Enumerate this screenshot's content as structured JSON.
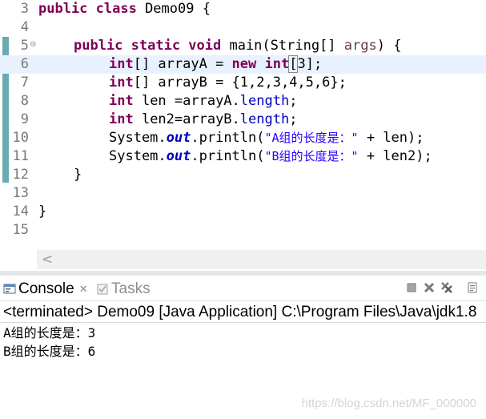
{
  "editor": {
    "line_numbers": [
      "3",
      "4",
      "5",
      "6",
      "7",
      "8",
      "9",
      "10",
      "11",
      "12",
      "13",
      "14",
      "15"
    ],
    "class_decl": {
      "kw": "public class",
      "rest": " Demo09 {"
    },
    "main_decl": {
      "kw": "public static void",
      "rest": " main(String[] ",
      "param": "args",
      "tail": ") {"
    },
    "line6": {
      "kw1": "int",
      "a": "[] arrayA = ",
      "kw2": "new",
      "sp": " ",
      "kw3": "int",
      "br": "[",
      "b": "3];"
    },
    "line7": {
      "kw": "int",
      "rest": "[] arrayB = {1,2,3,4,5,6};"
    },
    "line8": {
      "kw": "int",
      "rest": " len =arrayA.",
      "field": "length",
      "end": ";"
    },
    "line9": {
      "kw": "int",
      "rest": " len2=arrayB.",
      "field": "length",
      "end": ";"
    },
    "line10": {
      "pre": "System.",
      "field": "out",
      "mid": ".println(",
      "str": "\"A组的长度是：\"",
      "post": " + len);"
    },
    "line11": {
      "pre": "System.",
      "field": "out",
      "mid": ".println(",
      "str": "\"B组的长度是：\"",
      "post": " + len2);"
    },
    "close_method": "}",
    "close_class": "}",
    "fold_marker": "⊖",
    "scroll_left": "<"
  },
  "console": {
    "tabs": [
      {
        "label": "Console",
        "icon": "console-icon",
        "close": "✕",
        "active": true
      },
      {
        "label": "Tasks",
        "icon": "tasks-icon",
        "active": false
      }
    ],
    "toolbar_icons": [
      "terminate-icon",
      "remove-launch-icon",
      "remove-all-icon",
      "scroll-lock-icon"
    ],
    "status": "<terminated> Demo09 [Java Application] C:\\Program Files\\Java\\jdk1.8",
    "output": [
      "A组的长度是：3",
      "B组的长度是：6"
    ]
  },
  "watermark": "https://blog.csdn.net/MF_000000",
  "colors": {
    "keyword": "#7f0055",
    "string": "#2a00ff",
    "field": "#0000c0",
    "current_line": "#e8f2fe",
    "change_bar": "#6aaab0"
  }
}
